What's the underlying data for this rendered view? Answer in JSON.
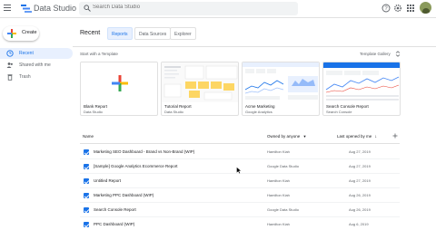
{
  "header": {
    "app_title": "Data Studio",
    "search_placeholder": "Search Data Studio"
  },
  "sidebar": {
    "create_label": "Create",
    "items": [
      {
        "label": "Recent",
        "icon": "clock-icon",
        "active": true
      },
      {
        "label": "Shared with me",
        "icon": "people-icon",
        "active": false
      },
      {
        "label": "Trash",
        "icon": "trash-icon",
        "active": false
      }
    ]
  },
  "main": {
    "title": "Recent",
    "tabs": [
      {
        "label": "Reports",
        "active": true
      },
      {
        "label": "Data Sources",
        "active": false
      },
      {
        "label": "Explorer",
        "active": false
      }
    ],
    "template_label": "Start with a Template",
    "template_gallery": "Template Gallery",
    "templates": [
      {
        "title": "Blank Report",
        "source": "Data Studio"
      },
      {
        "title": "Tutorial Report",
        "source": "Data Studio"
      },
      {
        "title": "Acme Marketing",
        "source": "Google Analytics"
      },
      {
        "title": "Search Console Report",
        "source": "Search Console"
      }
    ]
  },
  "table": {
    "columns": {
      "name": "Name",
      "owner": "Owned by anyone",
      "date": "Last opened by me"
    },
    "rows": [
      {
        "name": "Marketing SEO Dashboard - Brand vs Non-Brand (WIP)",
        "owner": "Hamilton Kiah",
        "date": "Aug 27, 2019"
      },
      {
        "name": "[Sample] Google Analytics Ecommerce Report",
        "owner": "Google Data Studio",
        "date": "Aug 27, 2019"
      },
      {
        "name": "Untitled Report",
        "owner": "Hamilton Kiah",
        "date": "Aug 27, 2019"
      },
      {
        "name": "Marketing PPC Dashboard (WIP)",
        "owner": "Hamilton Kiah",
        "date": "Aug 26, 2019"
      },
      {
        "name": "Search Console Report",
        "owner": "Google Data Studio",
        "date": "Aug 26, 2019"
      },
      {
        "name": "PPC Dashboard (WIP)",
        "owner": "Hamilton Kiah",
        "date": "Aug 6, 2019"
      }
    ]
  },
  "colors": {
    "accent": "#1a73e8",
    "active_bg": "#e8f0fe",
    "text": "#202124",
    "muted": "#5f6368"
  }
}
